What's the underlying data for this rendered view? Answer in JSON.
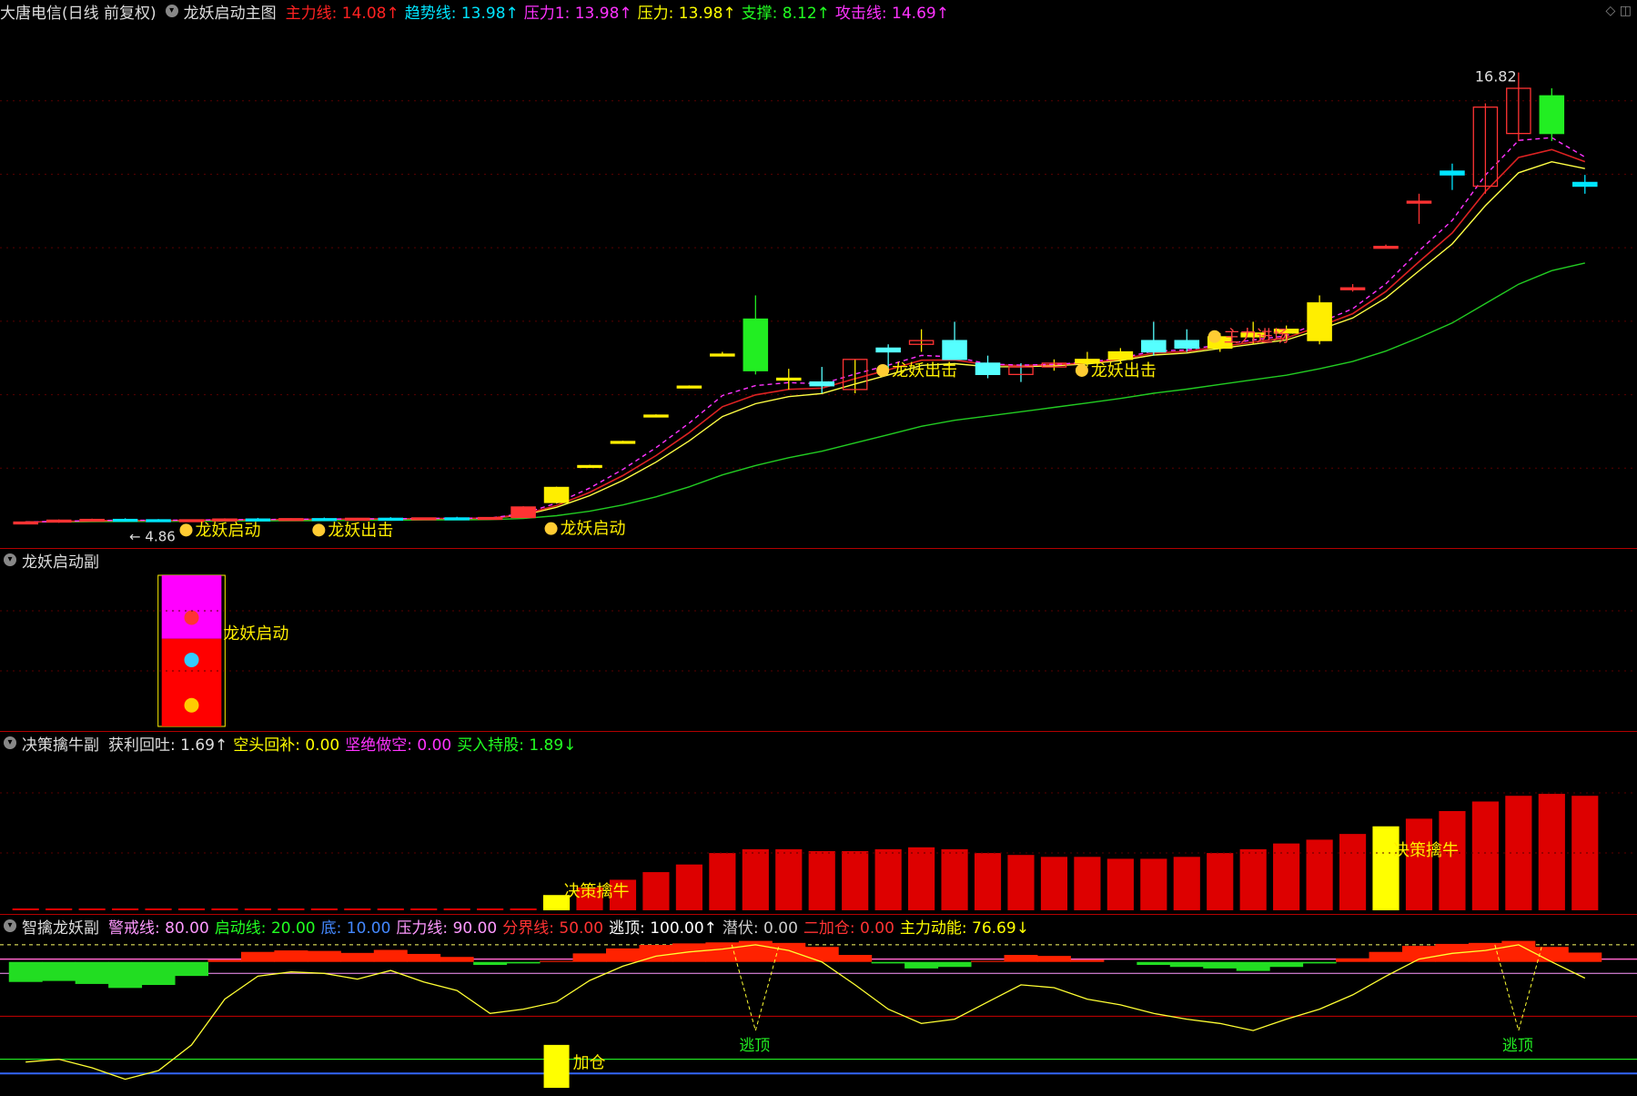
{
  "main": {
    "title": "大唐电信(日线 前复权)",
    "indicator": "龙妖启动主图",
    "indicators": [
      {
        "label": "主力线: 14.08↑",
        "color": "#ff2222"
      },
      {
        "label": "趋势线: 13.98↑",
        "color": "#00e5ff"
      },
      {
        "label": "压力1: 13.98↑",
        "color": "#ff33ff"
      },
      {
        "label": "压力: 13.98↑",
        "color": "#ffff00"
      },
      {
        "label": "支撑: 8.12↑",
        "color": "#22ff22"
      },
      {
        "label": "攻击线: 14.69↑",
        "color": "#ff33ff"
      }
    ],
    "high_label": "16.82",
    "low_label": "4.86",
    "tags": [
      "龙妖启动",
      "龙妖出击",
      "龙妖启动",
      "龙妖出击",
      "龙妖出击",
      "主力进场"
    ]
  },
  "sub1": {
    "title": "龙妖启动副",
    "tag": "龙妖启动"
  },
  "sub2": {
    "title": "决策擒牛副",
    "indicators": [
      {
        "label": "获利回吐: 1.69↑",
        "color": "#dddddd"
      },
      {
        "label": "空头回补: 0.00",
        "color": "#ffff00"
      },
      {
        "label": "坚绝做空: 0.00",
        "color": "#ff33ff"
      },
      {
        "label": "买入持股: 1.89↓",
        "color": "#22ff22"
      }
    ],
    "tag": "决策擒牛"
  },
  "sub3": {
    "title": "智擒龙妖副",
    "indicators": [
      {
        "label": "警戒线: 80.00",
        "color": "#ff99ff"
      },
      {
        "label": "启动线: 20.00",
        "color": "#22ff22"
      },
      {
        "label": "底: 10.00",
        "color": "#4488ff"
      },
      {
        "label": "压力线: 90.00",
        "color": "#ff99ff"
      },
      {
        "label": "分界线: 50.00",
        "color": "#ff3333"
      },
      {
        "label": "逃顶: 100.00↑",
        "color": "#ffffff"
      },
      {
        "label": "潜伏: 0.00",
        "color": "#cccccc"
      },
      {
        "label": "二加仓: 0.00",
        "color": "#ff3333"
      },
      {
        "label": "主力动能: 76.69↓",
        "color": "#ffff00"
      }
    ],
    "tags": [
      "逃顶",
      "逃顶",
      "加仓"
    ]
  },
  "chart_data": [
    {
      "type": "candlestick",
      "title": "龙妖启动主图",
      "series": [
        {
          "name": "K线",
          "values": [
            [
              4.86,
              4.9,
              4.84,
              4.88
            ],
            [
              4.88,
              4.95,
              4.86,
              4.93
            ],
            [
              4.93,
              4.97,
              4.9,
              4.95
            ],
            [
              4.95,
              4.98,
              4.92,
              4.94
            ],
            [
              4.94,
              4.96,
              4.9,
              4.92
            ],
            [
              4.92,
              4.95,
              4.9,
              4.94
            ],
            [
              4.94,
              4.98,
              4.92,
              4.96
            ],
            [
              4.96,
              4.99,
              4.93,
              4.95
            ],
            [
              4.95,
              4.98,
              4.92,
              4.97
            ],
            [
              4.97,
              5.0,
              4.94,
              4.96
            ],
            [
              4.96,
              4.99,
              4.93,
              4.98
            ],
            [
              4.98,
              5.01,
              4.95,
              4.97
            ],
            [
              4.97,
              5.0,
              4.94,
              4.99
            ],
            [
              4.99,
              5.02,
              4.96,
              4.98
            ],
            [
              4.98,
              5.01,
              4.95,
              5.0
            ],
            [
              5.0,
              5.3,
              4.99,
              5.28
            ],
            [
              5.4,
              5.82,
              5.38,
              5.8
            ],
            [
              6.38,
              6.4,
              6.36,
              6.38
            ],
            [
              7.02,
              7.04,
              7.0,
              7.02
            ],
            [
              7.72,
              7.74,
              7.7,
              7.72
            ],
            [
              8.49,
              8.51,
              8.47,
              8.49
            ],
            [
              9.34,
              9.4,
              9.3,
              9.34
            ],
            [
              10.27,
              10.9,
              8.8,
              8.9
            ],
            [
              8.7,
              8.95,
              8.4,
              8.7
            ],
            [
              8.6,
              9.0,
              8.3,
              8.5
            ],
            [
              8.4,
              9.2,
              8.3,
              9.2
            ],
            [
              9.5,
              9.6,
              8.9,
              9.4
            ],
            [
              9.6,
              10.0,
              9.4,
              9.7
            ],
            [
              9.7,
              10.2,
              9.6,
              9.2
            ],
            [
              9.1,
              9.3,
              8.7,
              8.8
            ],
            [
              8.8,
              9.1,
              8.6,
              9.0
            ],
            [
              9.0,
              9.2,
              8.9,
              9.1
            ],
            [
              9.1,
              9.4,
              9.0,
              9.2
            ],
            [
              9.2,
              9.5,
              9.1,
              9.4
            ],
            [
              9.4,
              10.2,
              9.3,
              9.7
            ],
            [
              9.7,
              10.0,
              9.4,
              9.5
            ],
            [
              9.5,
              9.9,
              9.4,
              9.8
            ],
            [
              9.8,
              10.2,
              9.6,
              9.9
            ],
            [
              9.9,
              10.1,
              9.7,
              10.0
            ],
            [
              9.7,
              10.9,
              9.6,
              10.7
            ],
            [
              11.1,
              11.2,
              11.0,
              11.1
            ],
            [
              12.2,
              12.25,
              12.15,
              12.2
            ],
            [
              13.4,
              13.6,
              12.8,
              13.4
            ],
            [
              14.2,
              14.4,
              13.7,
              14.1
            ],
            [
              13.8,
              16.0,
              13.6,
              15.9
            ],
            [
              15.2,
              16.82,
              15.0,
              16.4
            ],
            [
              16.2,
              16.4,
              15.0,
              15.2
            ],
            [
              13.9,
              14.1,
              13.6,
              13.8
            ]
          ]
        }
      ],
      "high": 16.82,
      "low": 4.86
    },
    {
      "type": "bar",
      "title": "决策擒牛副",
      "series": [
        {
          "name": "获利回吐",
          "values": [
            0.05,
            0.05,
            0.05,
            0.05,
            0.05,
            0.05,
            0.05,
            0.05,
            0.05,
            0.05,
            0.05,
            0.05,
            0.05,
            0.05,
            0.05,
            0.05,
            0.4,
            0.6,
            0.8,
            1.0,
            1.2,
            1.5,
            1.6,
            1.6,
            1.55,
            1.55,
            1.6,
            1.65,
            1.6,
            1.5,
            1.45,
            1.4,
            1.4,
            1.35,
            1.35,
            1.4,
            1.5,
            1.6,
            1.75,
            1.85,
            2.0,
            2.2,
            2.4,
            2.6,
            2.85,
            3.0,
            3.05,
            3.0
          ]
        }
      ]
    },
    {
      "type": "line",
      "title": "智擒龙妖副",
      "series": [
        {
          "name": "主力动能",
          "values": [
            18,
            20,
            14,
            6,
            12,
            30,
            62,
            78,
            81,
            80,
            76,
            82,
            74,
            68,
            52,
            55,
            60,
            75,
            85,
            92,
            95,
            97,
            100,
            96,
            88,
            72,
            55,
            45,
            48,
            60,
            72,
            70,
            62,
            58,
            52,
            48,
            45,
            40,
            48,
            55,
            65,
            78,
            90,
            94,
            96,
            100,
            88,
            76.69
          ]
        }
      ],
      "levels": {
        "警戒线": 80,
        "启动线": 20,
        "底": 10,
        "压力线": 90,
        "分界线": 50
      }
    }
  ]
}
